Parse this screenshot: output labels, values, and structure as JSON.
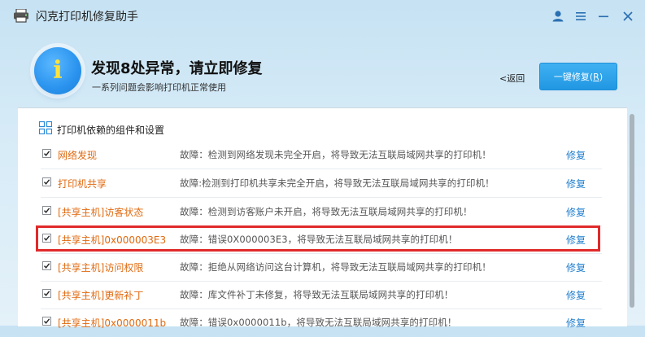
{
  "window": {
    "title": "闪克打印机修复助手"
  },
  "banner": {
    "icon_glyph": "i",
    "headline": "发现8处异常，请立即修复",
    "subline": "一系列问题会影响打印机正常使用",
    "back_label": "<返回",
    "fix_all_label": "一键修复(",
    "fix_all_hotkey": "R",
    "fix_all_close": ")"
  },
  "panel": {
    "section_title": "打印机依赖的组件和设置",
    "items": [
      {
        "name": "网络发现",
        "desc": "故障：检测到网络发现未完全开启，将导致无法互联局域网共享的打印机！",
        "action": "修复",
        "checked": true
      },
      {
        "name": "打印机共享",
        "desc": "故障:检测到打印机共享未完全开启，将导致无法互联局域网共享的打印机！",
        "action": "修复",
        "checked": true
      },
      {
        "name": "[共享主机]访客状态",
        "desc": "故障：检测到访客账户未开启，将导致无法互联局域网共享的打印机！",
        "action": "修复",
        "checked": true
      },
      {
        "name": "[共享主机]0x000003E3",
        "desc": "故障：错误0X000003E3，将导致无法互联局域网共享的打印机！",
        "action": "修复",
        "checked": true
      },
      {
        "name": "[共享主机]访问权限",
        "desc": "故障：拒绝从网络访问这台计算机，将导致无法互联局域网共享的打印机！",
        "action": "修复",
        "checked": true
      },
      {
        "name": "[共享主机]更新补丁",
        "desc": "故障：库文件补丁未修复，将导致无法互联局域网共享的打印机！",
        "action": "修复",
        "checked": true
      },
      {
        "name": "[共享主机]0x0000011b",
        "desc": "故障：错误0x0000011b，将导致无法互联局域网共享的打印机！",
        "action": "修复",
        "checked": true
      }
    ]
  },
  "colors": {
    "accent": "#2197e3",
    "warning_text": "#e06a10",
    "link": "#1f7fcf",
    "highlight_border": "#e02a2a"
  }
}
